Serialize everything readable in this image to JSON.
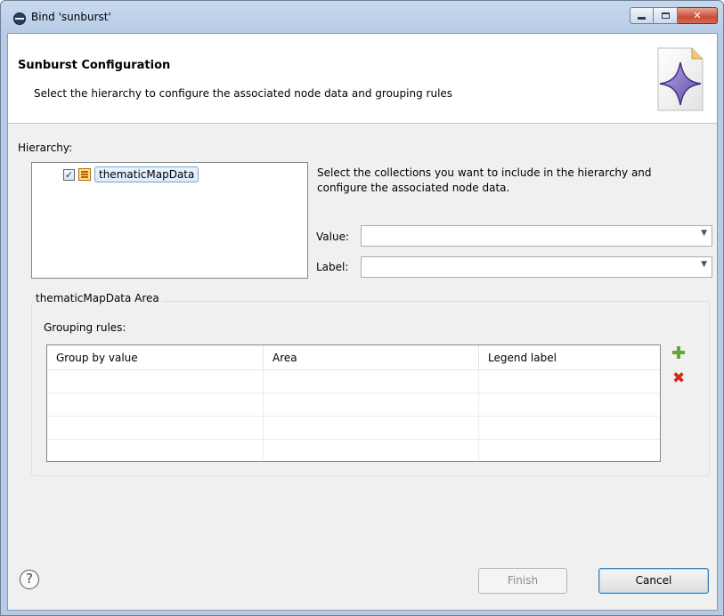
{
  "window": {
    "title": "Bind 'sunburst'"
  },
  "header": {
    "title": "Sunburst Configuration",
    "description": "Select the hierarchy to configure the associated node data and grouping rules"
  },
  "hierarchy": {
    "label": "Hierarchy:",
    "items": [
      {
        "label": "thematicMapData",
        "checked": true
      }
    ]
  },
  "instructions": "Select the collections you want to include in the hierarchy and configure the associated node data.",
  "value_field": {
    "label": "Value:",
    "value": ""
  },
  "label_field": {
    "label": "Label:",
    "value": ""
  },
  "area_group": {
    "title": "thematicMapData Area",
    "grouping_label": "Grouping rules:",
    "columns": [
      "Group by value",
      "Area",
      "Legend label"
    ],
    "rows": [
      [
        "",
        "",
        ""
      ],
      [
        "",
        "",
        ""
      ],
      [
        "",
        "",
        ""
      ],
      [
        "",
        "",
        ""
      ]
    ]
  },
  "buttons": {
    "finish": "Finish",
    "cancel": "Cancel"
  },
  "colors": {
    "add": "#5ea734",
    "remove": "#d12b20",
    "accent": "#3c7fb1"
  },
  "icons": [
    "app-icon",
    "wizard-banner-icon",
    "table-icon",
    "add-icon",
    "remove-icon",
    "help-icon"
  ]
}
